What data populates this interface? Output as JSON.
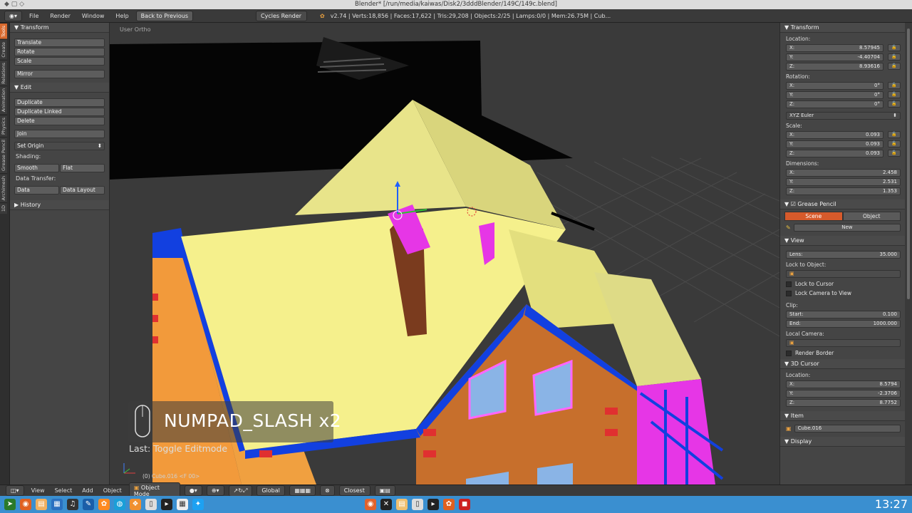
{
  "window": {
    "title": "Blender* [/run/media/kaiwas/Disk2/3dddBlender/149C/149c.blend]"
  },
  "header": {
    "menus": [
      "File",
      "Render",
      "Window",
      "Help"
    ],
    "back_button": "Back to Previous",
    "render_engine": "Cycles Render",
    "stats": "v2.74 | Verts:18,856 | Faces:17,622 | Tris:29,208 | Objects:2/25 | Lamps:0/0 | Mem:26.75M | Cub..."
  },
  "left_tabs": [
    "Tools",
    "Create",
    "Relations",
    "Animation",
    "Physics",
    "Grease Pencil",
    "Archimesh",
    "1D"
  ],
  "tool_shelf": {
    "transform_header": "Transform",
    "transform_buttons": [
      "Translate",
      "Rotate",
      "Scale"
    ],
    "mirror": "Mirror",
    "edit_header": "Edit",
    "edit_buttons": [
      "Duplicate",
      "Duplicate Linked",
      "Delete"
    ],
    "join": "Join",
    "set_origin": "Set Origin",
    "shading_label": "Shading:",
    "smooth": "Smooth",
    "flat": "Flat",
    "data_transfer_label": "Data Transfer:",
    "data": "Data",
    "data_layout": "Data Layout",
    "history_header": "History"
  },
  "viewport": {
    "view_label": "User Ortho",
    "object_label": "(0) Cube.016 <F 00>",
    "key_overlay": "NUMPAD_SLASH x2",
    "last_op": "Last: Toggle Editmode"
  },
  "properties": {
    "transform_header": "Transform",
    "location_label": "Location:",
    "location": [
      {
        "axis": "X:",
        "value": "8.57945"
      },
      {
        "axis": "Y:",
        "value": "-4.40704"
      },
      {
        "axis": "Z:",
        "value": "8.93616"
      }
    ],
    "rotation_label": "Rotation:",
    "rotation": [
      {
        "axis": "X:",
        "value": "0°"
      },
      {
        "axis": "Y:",
        "value": "0°"
      },
      {
        "axis": "Z:",
        "value": "0°"
      }
    ],
    "rotation_mode": "XYZ Euler",
    "scale_label": "Scale:",
    "scale": [
      {
        "axis": "X:",
        "value": "0.093"
      },
      {
        "axis": "Y:",
        "value": "0.093"
      },
      {
        "axis": "Z:",
        "value": "0.093"
      }
    ],
    "dimensions_label": "Dimensions:",
    "dimensions": [
      {
        "axis": "X:",
        "value": "2.458"
      },
      {
        "axis": "Y:",
        "value": "2.531"
      },
      {
        "axis": "Z:",
        "value": "1.353"
      }
    ],
    "grease_pencil_header": "Grease Pencil",
    "gp_tabs": [
      "Scene",
      "Object"
    ],
    "gp_new": "New",
    "view_header": "View",
    "lens_label": "Lens:",
    "lens": "35.000",
    "lock_to_object": "Lock to Object:",
    "lock_to_cursor": "Lock to Cursor",
    "lock_camera": "Lock Camera to View",
    "clip_label": "Clip:",
    "clip_start_label": "Start:",
    "clip_start": "0.100",
    "clip_end_label": "End:",
    "clip_end": "1000.000",
    "local_camera": "Local Camera:",
    "render_border": "Render Border",
    "cursor_header": "3D Cursor",
    "cursor_location_label": "Location:",
    "cursor": [
      {
        "axis": "X:",
        "value": "8.5794"
      },
      {
        "axis": "Y:",
        "value": "-2.3706"
      },
      {
        "axis": "Z:",
        "value": "8.7752"
      }
    ],
    "item_header": "Item",
    "item_name": "Cube.016",
    "display_header": "Display"
  },
  "bottom_bar": {
    "menus": [
      "View",
      "Select",
      "Add",
      "Object"
    ],
    "mode": "Object Mode",
    "orientation": "Global",
    "snap": "Closest"
  },
  "taskbar": {
    "clock": "13:27"
  }
}
